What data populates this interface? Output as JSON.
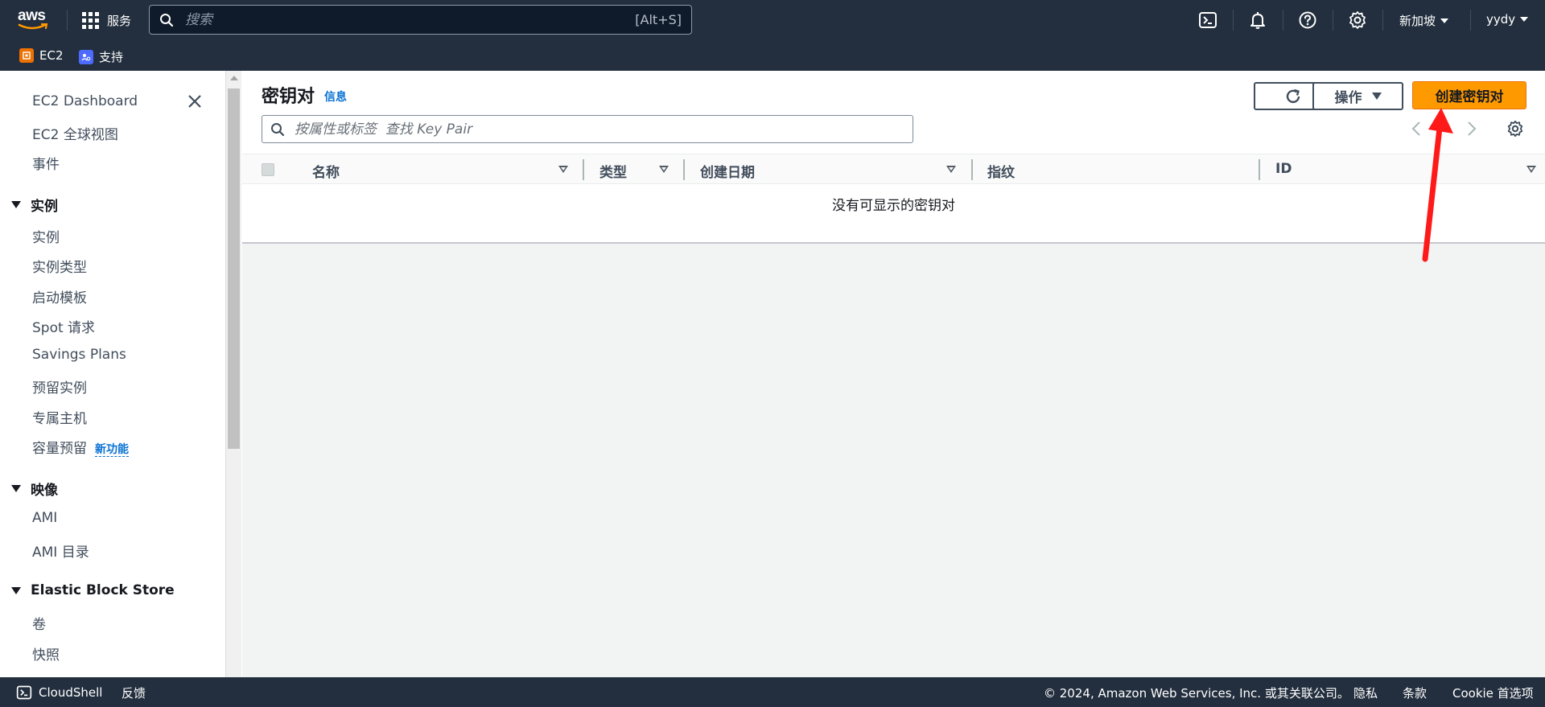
{
  "topbar": {
    "logo_text": "aws",
    "services_label": "服务",
    "search_placeholder": "搜索",
    "search_shortcut": "[Alt+S]",
    "region": "新加坡",
    "user": "yydy",
    "icons": [
      "cloudshell-icon",
      "bell-icon",
      "help-icon",
      "gear-icon"
    ]
  },
  "favorites": [
    {
      "label": "EC2",
      "color": "#ed7100"
    },
    {
      "label": "支持",
      "color": "#4d6bfe"
    }
  ],
  "sidebar": {
    "top_items": [
      "EC2 Dashboard",
      "EC2 全球视图",
      "事件"
    ],
    "sections": [
      {
        "title": "实例",
        "items": [
          "实例",
          "实例类型",
          "启动模板",
          "Spot 请求",
          "Savings Plans",
          "预留实例",
          "专属主机",
          "容量预留"
        ]
      },
      {
        "title": "映像",
        "items": [
          "AMI",
          "AMI 目录"
        ]
      },
      {
        "title": "Elastic Block Store",
        "items": [
          "卷",
          "快照"
        ]
      }
    ],
    "new_badge": "新功能"
  },
  "panel": {
    "title": "密钥对",
    "info": "信息",
    "actions_label": "操作",
    "create_label": "创建密钥对",
    "filter_placeholder": "按属性或标签  查找 Key Pair",
    "columns": [
      "名称",
      "类型",
      "创建日期",
      "指纹",
      "ID"
    ],
    "empty_text": "没有可显示的密钥对"
  },
  "footer": {
    "cloudshell": "CloudShell",
    "feedback": "反馈",
    "copyright": "© 2024, Amazon Web Services, Inc. 或其关联公司。",
    "privacy": "隐私",
    "terms": "条款",
    "cookie": "Cookie 首选项"
  },
  "colors": {
    "nav_bg": "#232f3e",
    "primary": "#ff9900",
    "link": "#0972d3",
    "annotation_arrow": "#ff1a1a"
  }
}
